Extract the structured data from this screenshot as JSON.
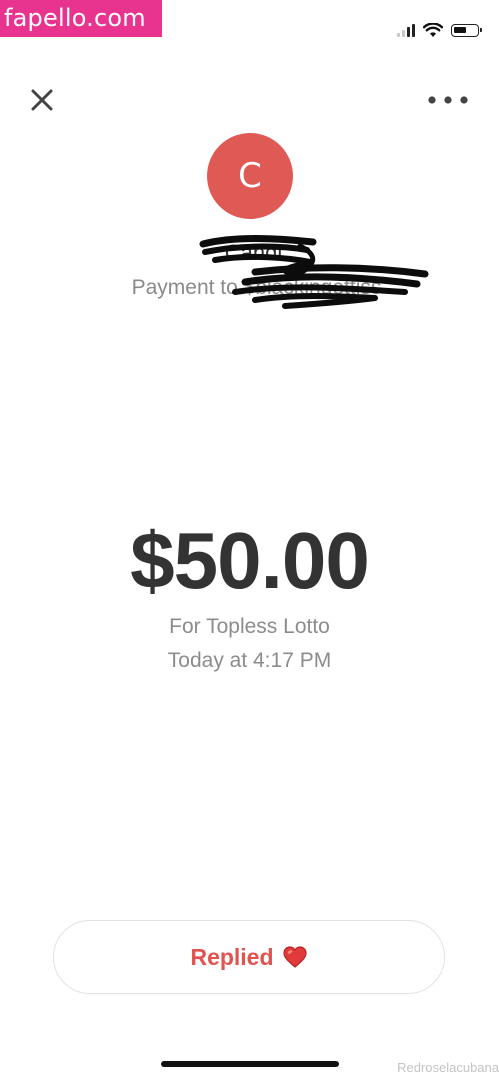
{
  "watermark": {
    "site": "fapello.com",
    "credit": "Redroselacubana",
    "site_bg": "#e8338f"
  },
  "status_bar": {
    "icons": [
      "signal-icon",
      "wifi-icon",
      "battery-icon"
    ]
  },
  "header": {
    "close_icon": "close-icon",
    "more_icon": "more-options-icon"
  },
  "recipient": {
    "avatar_initial": "C",
    "avatar_color": "#e05a55",
    "name": "Candi",
    "payment_to": "Payment to $blackingettiss"
  },
  "payment": {
    "amount": "$50.00",
    "note": "For Topless Lotto",
    "time": "Today at 4:17 PM"
  },
  "action": {
    "label": "Replied",
    "emoji": "heart-icon",
    "label_color": "#e0534e"
  }
}
